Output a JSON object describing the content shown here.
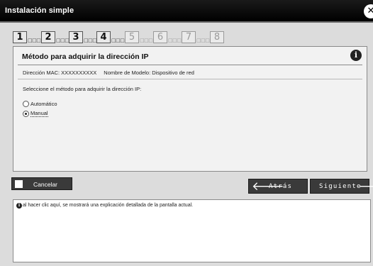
{
  "window": {
    "title": "Instalación simple",
    "close_glyph": "✕"
  },
  "steps": [
    {
      "number": "1",
      "dots": "□□□",
      "state": "active"
    },
    {
      "number": "2",
      "dots": "□□□",
      "state": "active"
    },
    {
      "number": "3",
      "dots": "□□□",
      "state": "active"
    },
    {
      "number": "4",
      "dots": "□□□",
      "state": "active"
    },
    {
      "number": "5",
      "dots": "□□□",
      "state": "inactive"
    },
    {
      "number": "6",
      "dots": "□□□",
      "state": "inactive"
    },
    {
      "number": "7",
      "dots": "□□□",
      "state": "inactive"
    },
    {
      "number": "8",
      "dots": "",
      "state": "inactive"
    }
  ],
  "panel": {
    "title": "Método para adquirir la dirección IP",
    "info_glyph": "i",
    "mac_label": "Dirección MAC: XXXXXXXXXX",
    "model_label": "Nombre de Modelo: Dispositivo de red",
    "prompt": "Seleccione el método para adquirir la dirección IP:",
    "options": [
      {
        "label": "Automático",
        "selected": false
      },
      {
        "label": "Manual",
        "selected": true
      }
    ]
  },
  "buttons": {
    "cancel": "Cancelar",
    "back": "Atrás",
    "next": "Siguiente",
    "back_arrow": "🡐",
    "next_arrow": "🡒"
  },
  "help": {
    "glyph": "i",
    "text": "al hacer clic aquí, se mostrará una explicación detallada de la pantalla actual."
  }
}
